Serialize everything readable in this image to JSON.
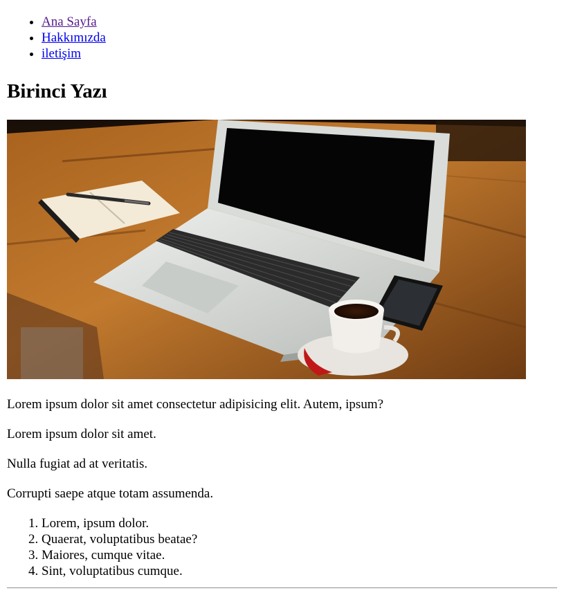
{
  "nav": {
    "items": [
      {
        "label": "Ana Sayfa",
        "visited": true
      },
      {
        "label": "Hakkımızda",
        "visited": false
      },
      {
        "label": "iletişim",
        "visited": false
      }
    ]
  },
  "post": {
    "title": "Birinci Yazı",
    "image_subject": "laptop-on-wooden-desk-with-notebook-coffee-and-phone",
    "paragraphs": [
      "Lorem ipsum dolor sit amet consectetur adipisicing elit. Autem, ipsum?",
      "Lorem ipsum dolor sit amet.",
      "Nulla fugiat ad at veritatis.",
      "Corrupti saepe atque totam assumenda."
    ],
    "list": [
      "Lorem, ipsum dolor.",
      "Quaerat, voluptatibus beatae?",
      "Maiores, cumque vitae.",
      "Sint, voluptatibus cumque."
    ]
  },
  "colors": {
    "link": "#0000ee",
    "link_visited": "#551a8b",
    "text": "#000000",
    "background": "#ffffff"
  }
}
